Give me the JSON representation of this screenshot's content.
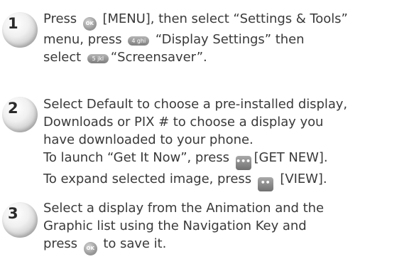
{
  "steps": [
    {
      "number": "1",
      "lines": [
        {
          "a": "Press ",
          "icon": "OK",
          "b": " [MENU], then select “Settings & Tools”"
        },
        {
          "a": "menu, press ",
          "icon": "4 ghi",
          "b": " “Display Settings” then"
        },
        {
          "a": "select ",
          "icon": "5 jkl",
          "b": "“Screensaver”."
        }
      ]
    },
    {
      "number": "2",
      "lines": [
        {
          "a": "Select Default to choose a pre-installed display,"
        },
        {
          "a": "Downloads or PIX # to choose a display you"
        },
        {
          "a": "have downloaded to your phone."
        },
        {
          "a": "To launch “Get It Now”, press ",
          "icon": "•••",
          "b": "[GET NEW]."
        },
        {
          "a": "To expand selected image, press ",
          "icon": "••",
          "b": " [VIEW]."
        }
      ]
    },
    {
      "number": "3",
      "lines": [
        {
          "a": "Select a display from the Animation and the"
        },
        {
          "a": "Graphic list using the Navigation Key and"
        },
        {
          "a": "press ",
          "icon": "OK",
          "b": " to save it."
        }
      ]
    }
  ],
  "icons": {
    "ok_key": "ok-key-icon",
    "number_key_4": "key-4-icon",
    "number_key_5": "key-5-icon",
    "left_soft_key": "left-softkey-icon",
    "right_soft_key": "right-softkey-icon"
  }
}
